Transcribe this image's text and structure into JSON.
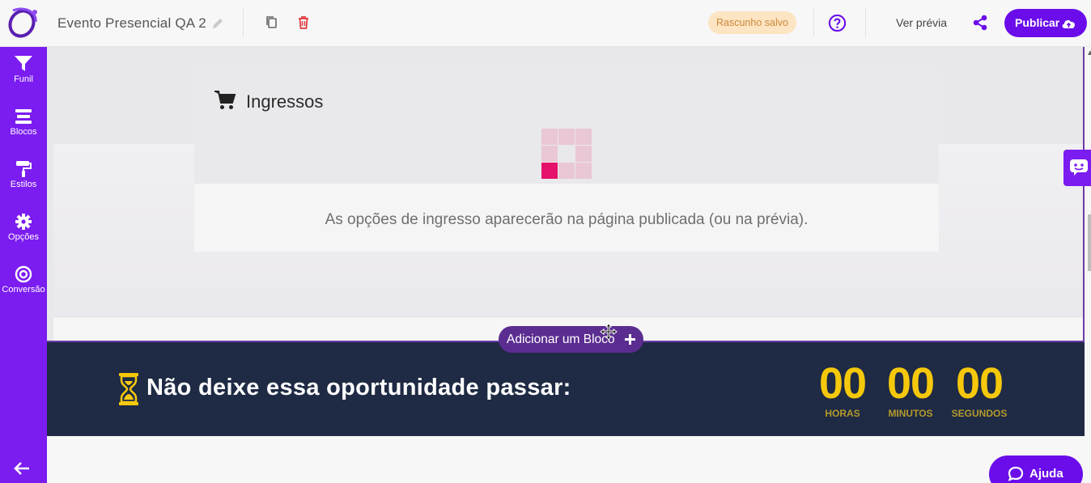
{
  "header": {
    "title": "Evento Presencial QA 2",
    "status_badge": "Rascunho salvo",
    "preview_label": "Ver prévia",
    "publish_label": "Publicar"
  },
  "sidebar": {
    "items": [
      {
        "label": "Funil",
        "icon": "funnel-icon"
      },
      {
        "label": "Blocos",
        "icon": "blocks-icon"
      },
      {
        "label": "Estilos",
        "icon": "paint-roller-icon"
      },
      {
        "label": "Opções",
        "icon": "gear-icon"
      },
      {
        "label": "Conversão",
        "icon": "target-icon"
      }
    ]
  },
  "tickets": {
    "title": "Ingressos",
    "message": "As opções de ingresso aparecerão na página publicada (ou na prévia)."
  },
  "add_block_label": "Adicionar um Bloco",
  "countdown": {
    "headline": "Não deixe essa oportunidade passar:",
    "hours": "00",
    "minutes": "00",
    "seconds": "00",
    "hours_label": "HORAS",
    "minutes_label": "MINUTOS",
    "seconds_label": "SEGUNDOS"
  },
  "help_button_label": "Ajuda",
  "colors": {
    "brand": "#7b1cf0",
    "publish": "#6a0dea",
    "banner": "#1f2a44",
    "countdown": "#f5c80b",
    "delete": "#e0383e",
    "loader_active": "#e5106a"
  }
}
